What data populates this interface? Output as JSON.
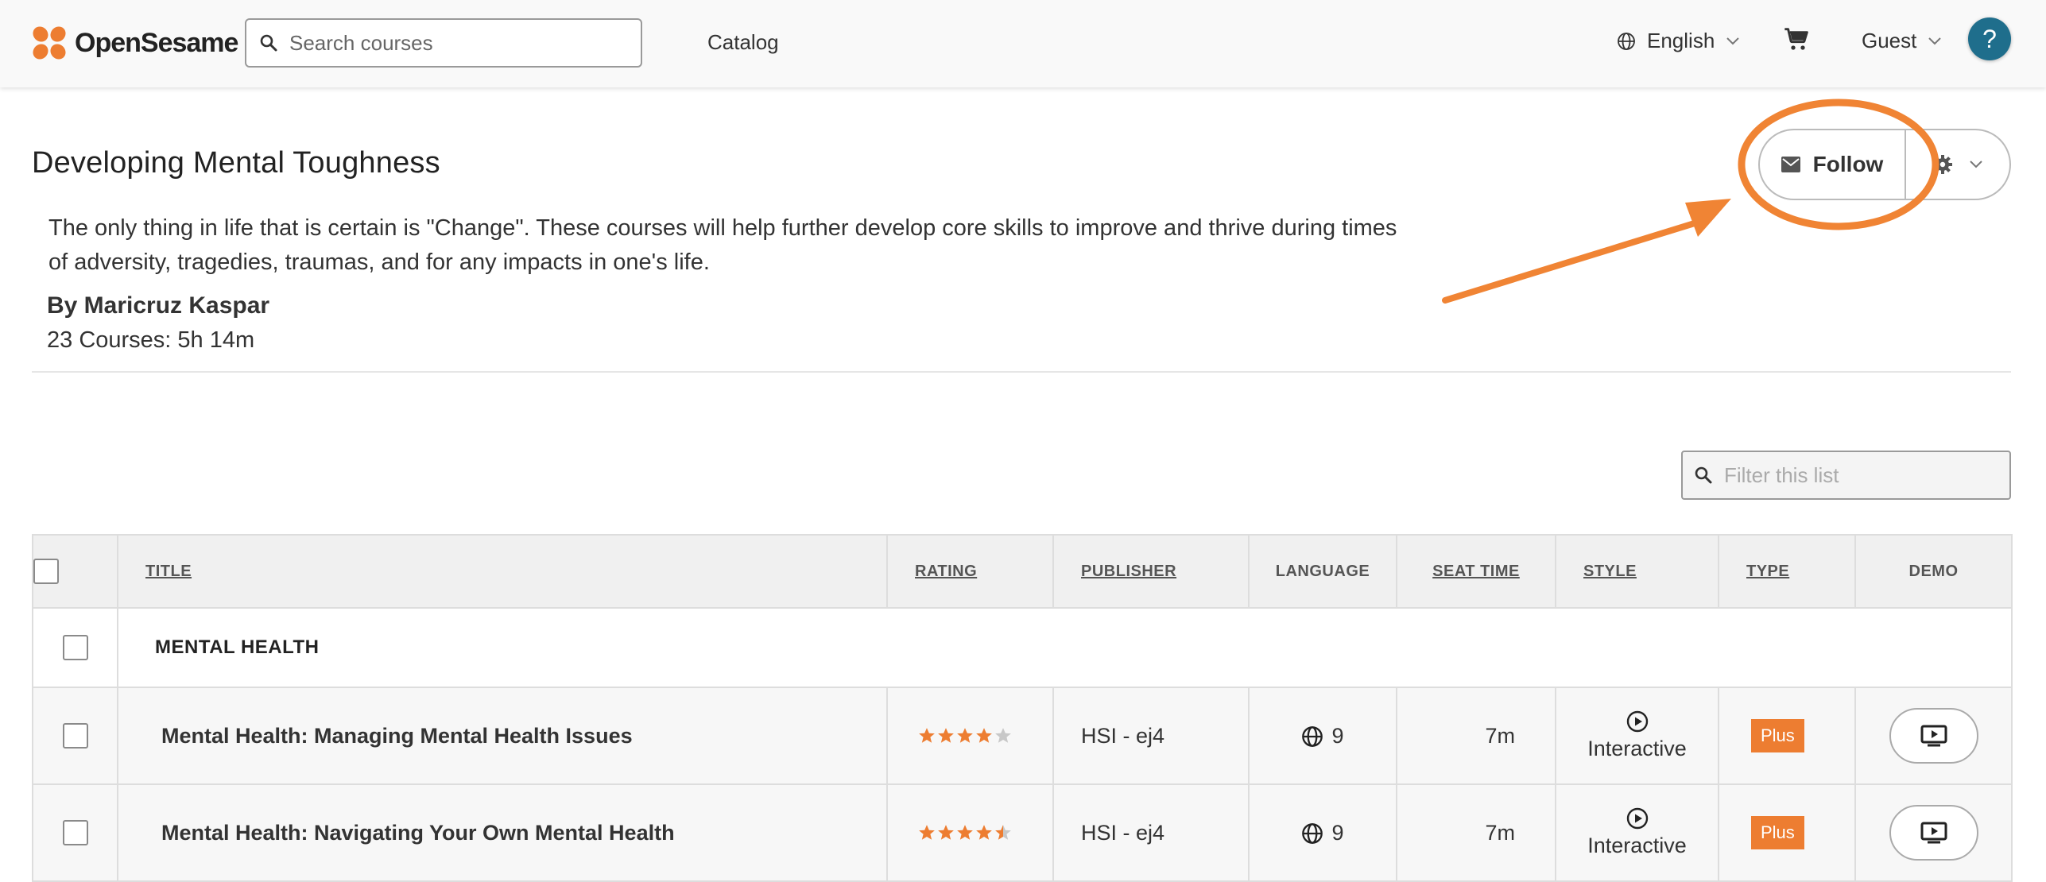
{
  "brand": {
    "name": "OpenSesame",
    "accent": "#ed7d31"
  },
  "nav": {
    "search_placeholder": "Search courses",
    "catalog_label": "Catalog",
    "language_label": "English",
    "account_label": "Guest",
    "help_label": "?"
  },
  "collection": {
    "title": "Developing Mental Toughness",
    "description": "The only thing in life that is certain is \"Change\". These courses will help further develop core skills to improve and thrive during times of adversity, tragedies, traumas, and for any impacts in one's life.",
    "author": "By Maricruz Kaspar",
    "summary": "23 Courses: 5h 14m",
    "follow_label": "Follow"
  },
  "filter": {
    "placeholder": "Filter this list"
  },
  "table": {
    "columns": {
      "title": "Title",
      "rating": "Rating",
      "publisher": "Publisher",
      "language": "Language",
      "seat_time": "Seat Time",
      "style": "Style",
      "type": "Type",
      "demo": "Demo"
    },
    "group": {
      "label": "MENTAL HEALTH"
    },
    "rows": [
      {
        "title": "Mental Health: Managing Mental Health Issues",
        "rating": 4,
        "publisher": "HSI - ej4",
        "languages": "9",
        "seat_time": "7m",
        "style": "Interactive",
        "type": "Plus"
      },
      {
        "title": "Mental Health: Navigating Your Own Mental Health",
        "rating": 4.5,
        "publisher": "HSI - ej4",
        "languages": "9",
        "seat_time": "7m",
        "style": "Interactive",
        "type": "Plus"
      }
    ]
  },
  "colors": {
    "help_button": "#1f6e8c",
    "badge": "#ed7d31",
    "annotation": "#f08434",
    "star_filled": "#ed7d31",
    "star_empty": "#c8c8c8"
  }
}
